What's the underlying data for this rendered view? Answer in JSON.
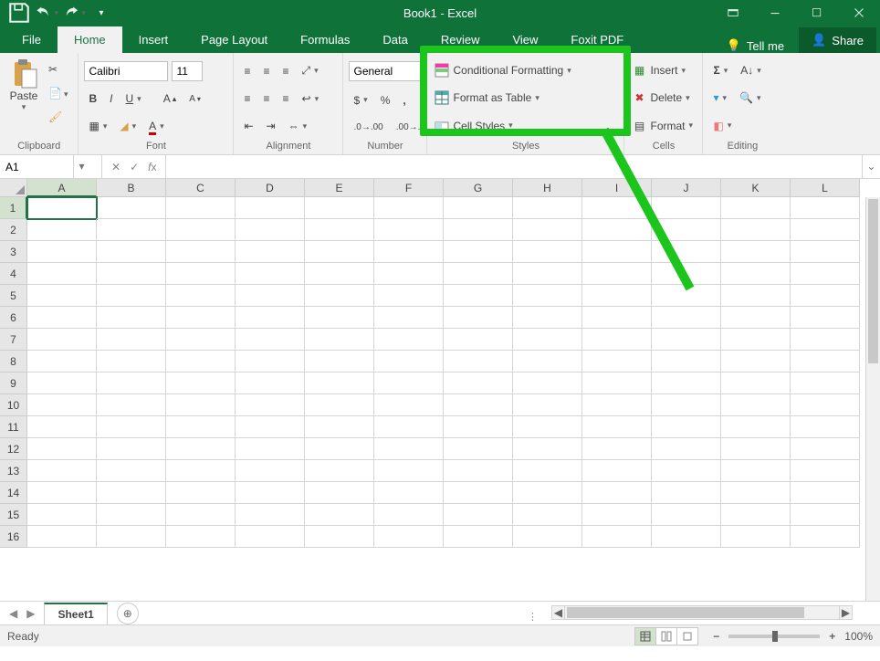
{
  "title": "Book1 - Excel",
  "tabs": [
    "File",
    "Home",
    "Insert",
    "Page Layout",
    "Formulas",
    "Data",
    "Review",
    "View",
    "Foxit PDF"
  ],
  "active_tab": "Home",
  "tellme": "Tell me",
  "share": "Share",
  "ribbon": {
    "clipboard": {
      "paste": "Paste",
      "label": "Clipboard"
    },
    "font": {
      "name": "Calibri",
      "size": "11",
      "label": "Font"
    },
    "alignment": {
      "label": "Alignment"
    },
    "number": {
      "format": "General",
      "label": "Number"
    },
    "styles": {
      "conditional": "Conditional Formatting",
      "table": "Format as Table",
      "cell": "Cell Styles",
      "label": "Styles"
    },
    "cells": {
      "insert": "Insert",
      "delete": "Delete",
      "format": "Format",
      "label": "Cells"
    },
    "editing": {
      "label": "Editing"
    }
  },
  "namebox": "A1",
  "columns": [
    "A",
    "B",
    "C",
    "D",
    "E",
    "F",
    "G",
    "H",
    "I",
    "J",
    "K",
    "L"
  ],
  "rows": [
    "1",
    "2",
    "3",
    "4",
    "5",
    "6",
    "7",
    "8",
    "9",
    "10",
    "11",
    "12",
    "13",
    "14",
    "15",
    "16"
  ],
  "active_cell": {
    "row": 0,
    "col": 0
  },
  "sheet": "Sheet1",
  "status": "Ready",
  "zoom": "100%"
}
